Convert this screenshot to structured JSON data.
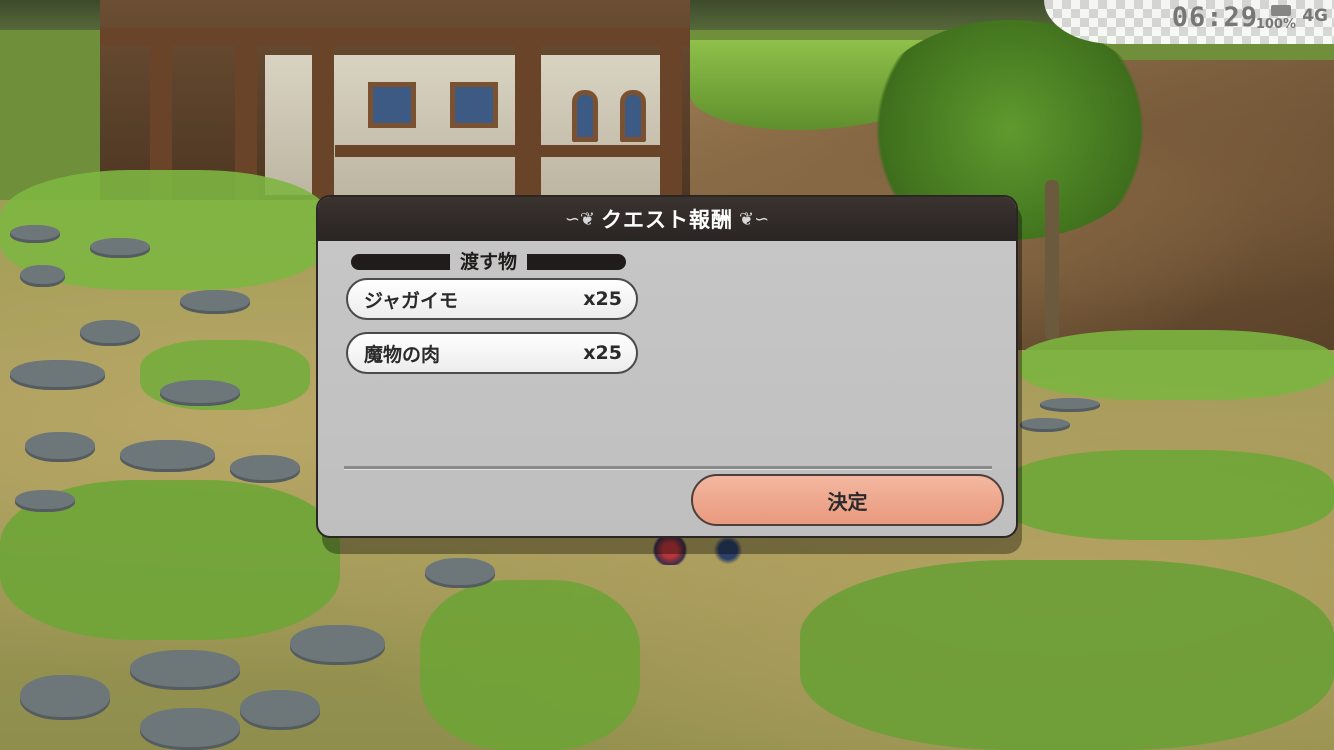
{
  "status_bar": {
    "time": "06:29",
    "battery": "100%",
    "network": "4G"
  },
  "dialog": {
    "title": "クエスト報酬",
    "section_label": "渡す物",
    "items": [
      {
        "name": "ジャガイモ",
        "qty": "x25"
      },
      {
        "name": "魔物の肉",
        "qty": "x25"
      }
    ],
    "confirm_label": "決定"
  }
}
